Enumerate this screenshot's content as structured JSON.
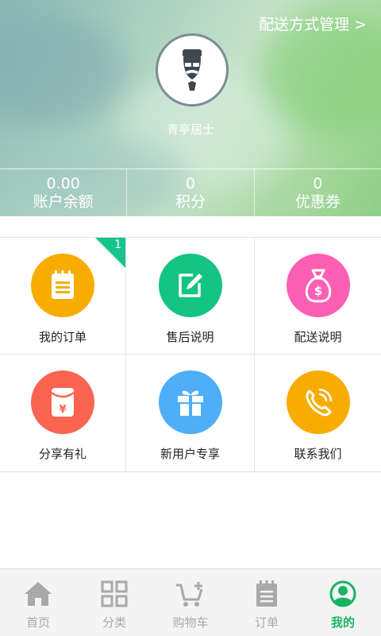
{
  "header": {
    "delivery_link": "配送方式管理 >",
    "username": "青亭居士"
  },
  "stats": [
    {
      "value": "0.00",
      "label": "账户余额"
    },
    {
      "value": "0",
      "label": "积分"
    },
    {
      "value": "0",
      "label": "优惠券"
    }
  ],
  "menu": [
    {
      "label": "我的订单",
      "icon": "notepad-icon",
      "color": "#f8ac00",
      "badge": "1"
    },
    {
      "label": "售后说明",
      "icon": "edit-icon",
      "color": "#13c482"
    },
    {
      "label": "配送说明",
      "icon": "money-bag-icon",
      "color": "#fc5fb3"
    },
    {
      "label": "分享有礼",
      "icon": "red-envelope-icon",
      "color": "#fb6450"
    },
    {
      "label": "新用户专享",
      "icon": "gift-icon",
      "color": "#4eaef8"
    },
    {
      "label": "联系我们",
      "icon": "phone-icon",
      "color": "#f8ac00"
    }
  ],
  "tabbar": [
    {
      "label": "首页",
      "icon": "home-icon"
    },
    {
      "label": "分类",
      "icon": "category-grid-icon"
    },
    {
      "label": "购物车",
      "icon": "cart-icon"
    },
    {
      "label": "订单",
      "icon": "order-icon"
    },
    {
      "label": "我的",
      "icon": "user-icon",
      "active": true
    }
  ],
  "colors": {
    "accent": "#18b463",
    "badge": "#19c38c",
    "inactive": "#a9a9a9"
  }
}
